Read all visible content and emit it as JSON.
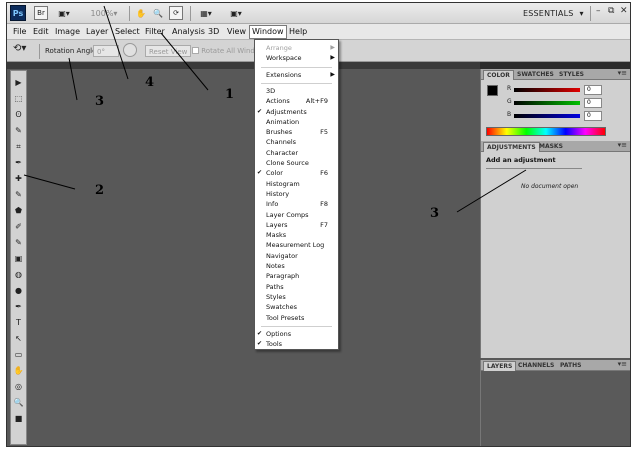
{
  "appbar": {
    "logo": "Ps",
    "buttons": [
      "Br",
      "▣▾",
      "100%▾"
    ],
    "workspace": "ESSENTIALS",
    "workspace_arrow": "▾",
    "win_min": "–",
    "win_max": "🗗",
    "win_close": "✕"
  },
  "menus": [
    "File",
    "Edit",
    "Image",
    "Layer",
    "Select",
    "Filter",
    "Analysis",
    "3D",
    "View",
    "Window",
    "Help"
  ],
  "options": {
    "rotation_label": "Rotation Angle:",
    "rotation_value": "0°",
    "reset_view": "Reset View",
    "rotate_all": "Rotate All Windows"
  },
  "window_menu": [
    {
      "label": "Arrange",
      "shortcut": "",
      "submenu": true,
      "disabled": true,
      "checked": false
    },
    {
      "label": "Workspace",
      "shortcut": "",
      "submenu": true,
      "disabled": false,
      "checked": false
    },
    {
      "label": "Extensions",
      "shortcut": "",
      "submenu": true,
      "disabled": false,
      "checked": false
    },
    {
      "label": "3D",
      "shortcut": "",
      "submenu": false,
      "disabled": false,
      "checked": false
    },
    {
      "label": "Actions",
      "shortcut": "Alt+F9",
      "submenu": false,
      "disabled": false,
      "checked": false
    },
    {
      "label": "Adjustments",
      "shortcut": "",
      "submenu": false,
      "disabled": false,
      "checked": true
    },
    {
      "label": "Animation",
      "shortcut": "",
      "submenu": false,
      "disabled": false,
      "checked": false
    },
    {
      "label": "Brushes",
      "shortcut": "F5",
      "submenu": false,
      "disabled": false,
      "checked": false
    },
    {
      "label": "Channels",
      "shortcut": "",
      "submenu": false,
      "disabled": false,
      "checked": false
    },
    {
      "label": "Character",
      "shortcut": "",
      "submenu": false,
      "disabled": false,
      "checked": false
    },
    {
      "label": "Clone Source",
      "shortcut": "",
      "submenu": false,
      "disabled": false,
      "checked": false
    },
    {
      "label": "Color",
      "shortcut": "F6",
      "submenu": false,
      "disabled": false,
      "checked": true
    },
    {
      "label": "Histogram",
      "shortcut": "",
      "submenu": false,
      "disabled": false,
      "checked": false
    },
    {
      "label": "History",
      "shortcut": "",
      "submenu": false,
      "disabled": false,
      "checked": false
    },
    {
      "label": "Info",
      "shortcut": "F8",
      "submenu": false,
      "disabled": false,
      "checked": false
    },
    {
      "label": "Layer Comps",
      "shortcut": "",
      "submenu": false,
      "disabled": false,
      "checked": false
    },
    {
      "label": "Layers",
      "shortcut": "F7",
      "submenu": false,
      "disabled": false,
      "checked": false
    },
    {
      "label": "Masks",
      "shortcut": "",
      "submenu": false,
      "disabled": false,
      "checked": false
    },
    {
      "label": "Measurement Log",
      "shortcut": "",
      "submenu": false,
      "disabled": false,
      "checked": false
    },
    {
      "label": "Navigator",
      "shortcut": "",
      "submenu": false,
      "disabled": false,
      "checked": false
    },
    {
      "label": "Notes",
      "shortcut": "",
      "submenu": false,
      "disabled": false,
      "checked": false
    },
    {
      "label": "Paragraph",
      "shortcut": "",
      "submenu": false,
      "disabled": false,
      "checked": false
    },
    {
      "label": "Paths",
      "shortcut": "",
      "submenu": false,
      "disabled": false,
      "checked": false
    },
    {
      "label": "Styles",
      "shortcut": "",
      "submenu": false,
      "disabled": false,
      "checked": false
    },
    {
      "label": "Swatches",
      "shortcut": "",
      "submenu": false,
      "disabled": false,
      "checked": false
    },
    {
      "label": "Tool Presets",
      "shortcut": "",
      "submenu": false,
      "disabled": false,
      "checked": false
    },
    {
      "label": "Options",
      "shortcut": "",
      "submenu": false,
      "disabled": false,
      "checked": true
    },
    {
      "label": "Tools",
      "shortcut": "",
      "submenu": false,
      "disabled": false,
      "checked": true
    }
  ],
  "checkmark": "✔",
  "submenu_arrow": "▶",
  "tools": [
    "▶",
    "⬚",
    "ʘ",
    "✎",
    "⌗",
    "✒",
    "✚",
    "✎",
    "⬟",
    "✐",
    "✎",
    "▣",
    "◍",
    "●",
    "✒",
    "T",
    "↖",
    "▭",
    "✋",
    "◎",
    "🔍",
    "■"
  ],
  "color_panel": {
    "tabs": [
      "COLOR",
      "SWATCHES",
      "STYLES"
    ],
    "channels": [
      {
        "label": "R",
        "value": "0",
        "color": "#e00000"
      },
      {
        "label": "G",
        "value": "0",
        "color": "#00c000"
      },
      {
        "label": "B",
        "value": "0",
        "color": "#0000e0"
      }
    ],
    "menu_icon": "▾≡"
  },
  "adjustments_panel": {
    "tabs": [
      "ADJUSTMENTS",
      "MASKS"
    ],
    "title": "Add an adjustment",
    "message": "No document open",
    "menu_icon": "▾≡"
  },
  "layers_panel": {
    "tabs": [
      "LAYERS",
      "CHANNELS",
      "PATHS"
    ],
    "menu_icon": "▾≡"
  },
  "annotations": [
    "1",
    "2",
    "3",
    "3",
    "4"
  ]
}
